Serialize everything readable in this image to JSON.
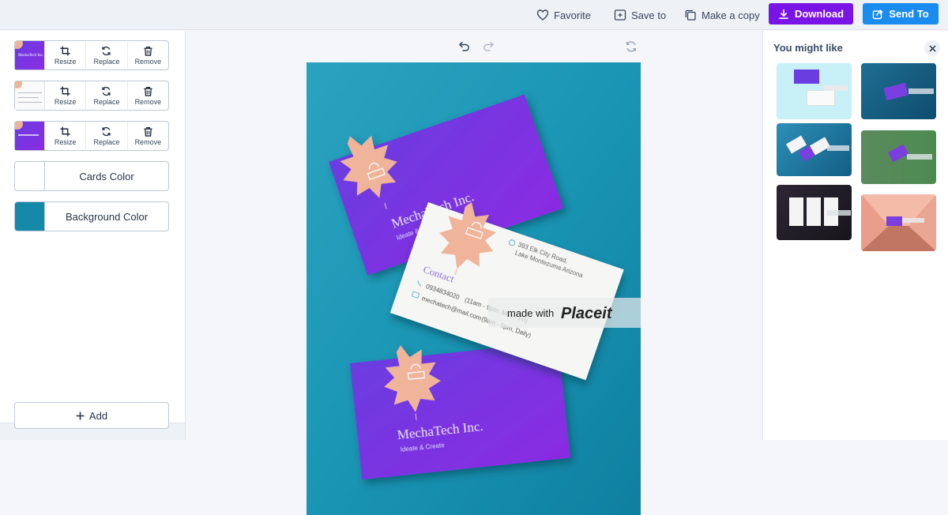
{
  "toolbar": {
    "favorite": "Favorite",
    "save_to": "Save to",
    "make_copy": "Make a copy",
    "download": "Download",
    "send_to": "Send To"
  },
  "colors": {
    "download_bg": "#7a14e6",
    "send_bg": "#1a8cf0",
    "card_purple_a": "#6a3de0",
    "card_purple_b": "#8a2be2",
    "background_teal": "#1589a8",
    "accent_peach": "#f0b49a"
  },
  "image_rows": [
    {
      "resize": "Resize",
      "replace": "Replace",
      "remove": "Remove"
    },
    {
      "resize": "Resize",
      "replace": "Replace",
      "remove": "Remove"
    },
    {
      "resize": "Resize",
      "replace": "Replace",
      "remove": "Remove"
    }
  ],
  "color_rows": {
    "cards": {
      "label": "Cards Color",
      "swatch": "#ffffff"
    },
    "background": {
      "label": "Background Color",
      "swatch": "#1589a8"
    }
  },
  "add_label": "Add",
  "mockup": {
    "company": "MechaTech Inc.",
    "tagline": "Ideate & Create",
    "contact_heading": "Contact",
    "address_line1": "393 Elk City Road,",
    "address_line2": "Lake Montezuma Arizona",
    "phone": "0934834020",
    "phone_hours": "(11am - 9pm, Mon - Fri)",
    "email": "mechatech@mail.com",
    "email_hours": "(9am - 5pm, Daily)",
    "watermark_pre": "made with",
    "watermark_brand": "Placeit"
  },
  "right_panel": {
    "title": "You might like"
  },
  "icons": {
    "favorite": "heart-icon",
    "save_to": "folder-plus-icon",
    "make_copy": "copy-icon",
    "download": "download-icon",
    "send_to": "share-icon",
    "undo": "undo-icon",
    "redo": "redo-icon",
    "reset": "refresh-icon",
    "close": "close-icon",
    "resize": "crop-icon",
    "replace": "replace-icon",
    "remove": "trash-icon",
    "add": "plus-icon"
  }
}
